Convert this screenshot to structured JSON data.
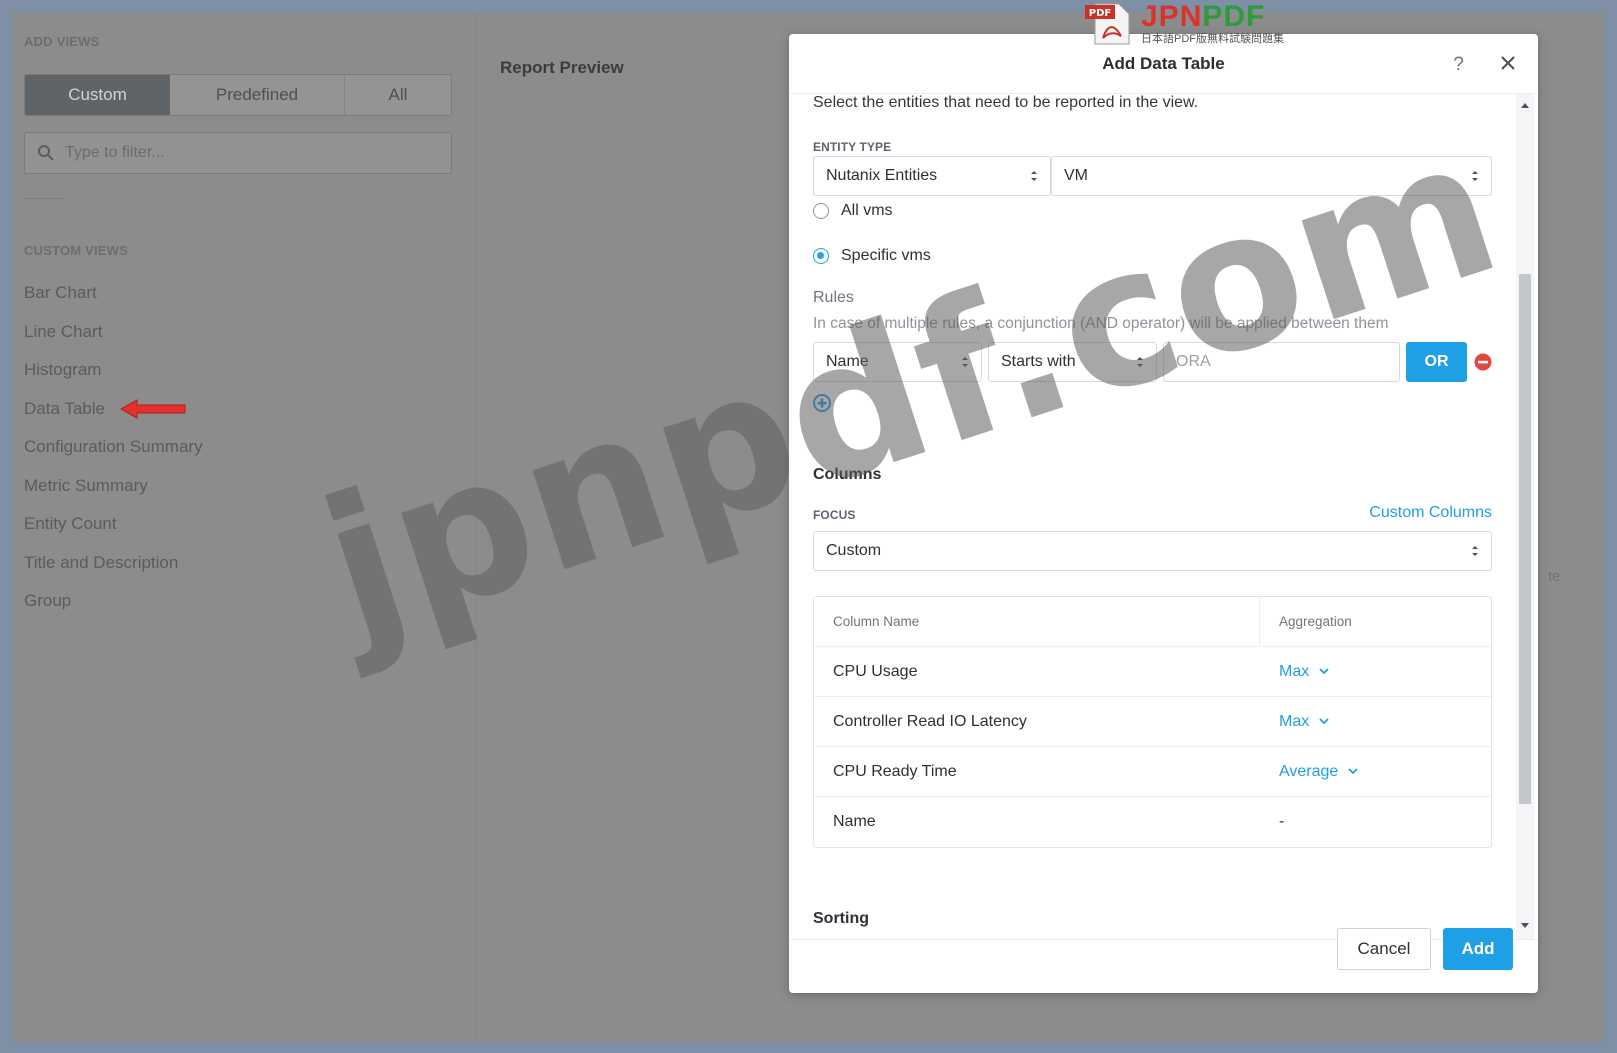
{
  "left_panel": {
    "add_views_title": "ADD VIEWS",
    "tabs": [
      {
        "label": "Custom",
        "active": true
      },
      {
        "label": "Predefined",
        "active": false
      },
      {
        "label": "All",
        "active": false
      }
    ],
    "filter_placeholder": "Type to filter...",
    "custom_views_title": "CUSTOM VIEWS",
    "custom_views": [
      "Bar Chart",
      "Line Chart",
      "Histogram",
      "Data Table",
      "Configuration Summary",
      "Metric Summary",
      "Entity Count",
      "Title and Description",
      "Group"
    ]
  },
  "preview": {
    "title": "Report Preview",
    "fragment": "te"
  },
  "watermark": {
    "text": "jpnpdf.com",
    "logo_main_j": "JPN",
    "logo_main_p": "PDF",
    "logo_sub": "日本語PDF版無料試験問題集",
    "logo_badge": "PDF"
  },
  "modal": {
    "title": "Add Data Table",
    "help": "?",
    "intro": "Select the entities that need to be reported in the view.",
    "entity_type_label": "ENTITY TYPE",
    "entity_category": "Nutanix Entities",
    "entity_type": "VM",
    "radio_all": "All vms",
    "radio_specific": "Specific vms",
    "selected_radio": "Specific vms",
    "rules_title": "Rules",
    "rules_desc": "In case of multiple rules, a conjunction (AND operator) will be applied between them",
    "rule": {
      "field": "Name",
      "operator": "Starts with",
      "value": "ORA",
      "or_label": "OR"
    },
    "columns_title": "Columns",
    "focus_label": "FOCUS",
    "custom_columns_link": "Custom Columns",
    "focus_value": "Custom",
    "table": {
      "headers": [
        "Column Name",
        "Aggregation"
      ],
      "rows": [
        {
          "name": "CPU Usage",
          "aggregation": "Max",
          "dropdown": true
        },
        {
          "name": "Controller Read IO Latency",
          "aggregation": "Max",
          "dropdown": true
        },
        {
          "name": "CPU Ready Time",
          "aggregation": "Average",
          "dropdown": true
        },
        {
          "name": "Name",
          "aggregation": "-",
          "dropdown": false
        }
      ]
    },
    "sorting_title": "Sorting",
    "cancel_label": "Cancel",
    "add_label": "Add"
  },
  "colors": {
    "accent": "#1e9fe6",
    "remove": "#e2463d",
    "arrow": "#e2302a"
  }
}
